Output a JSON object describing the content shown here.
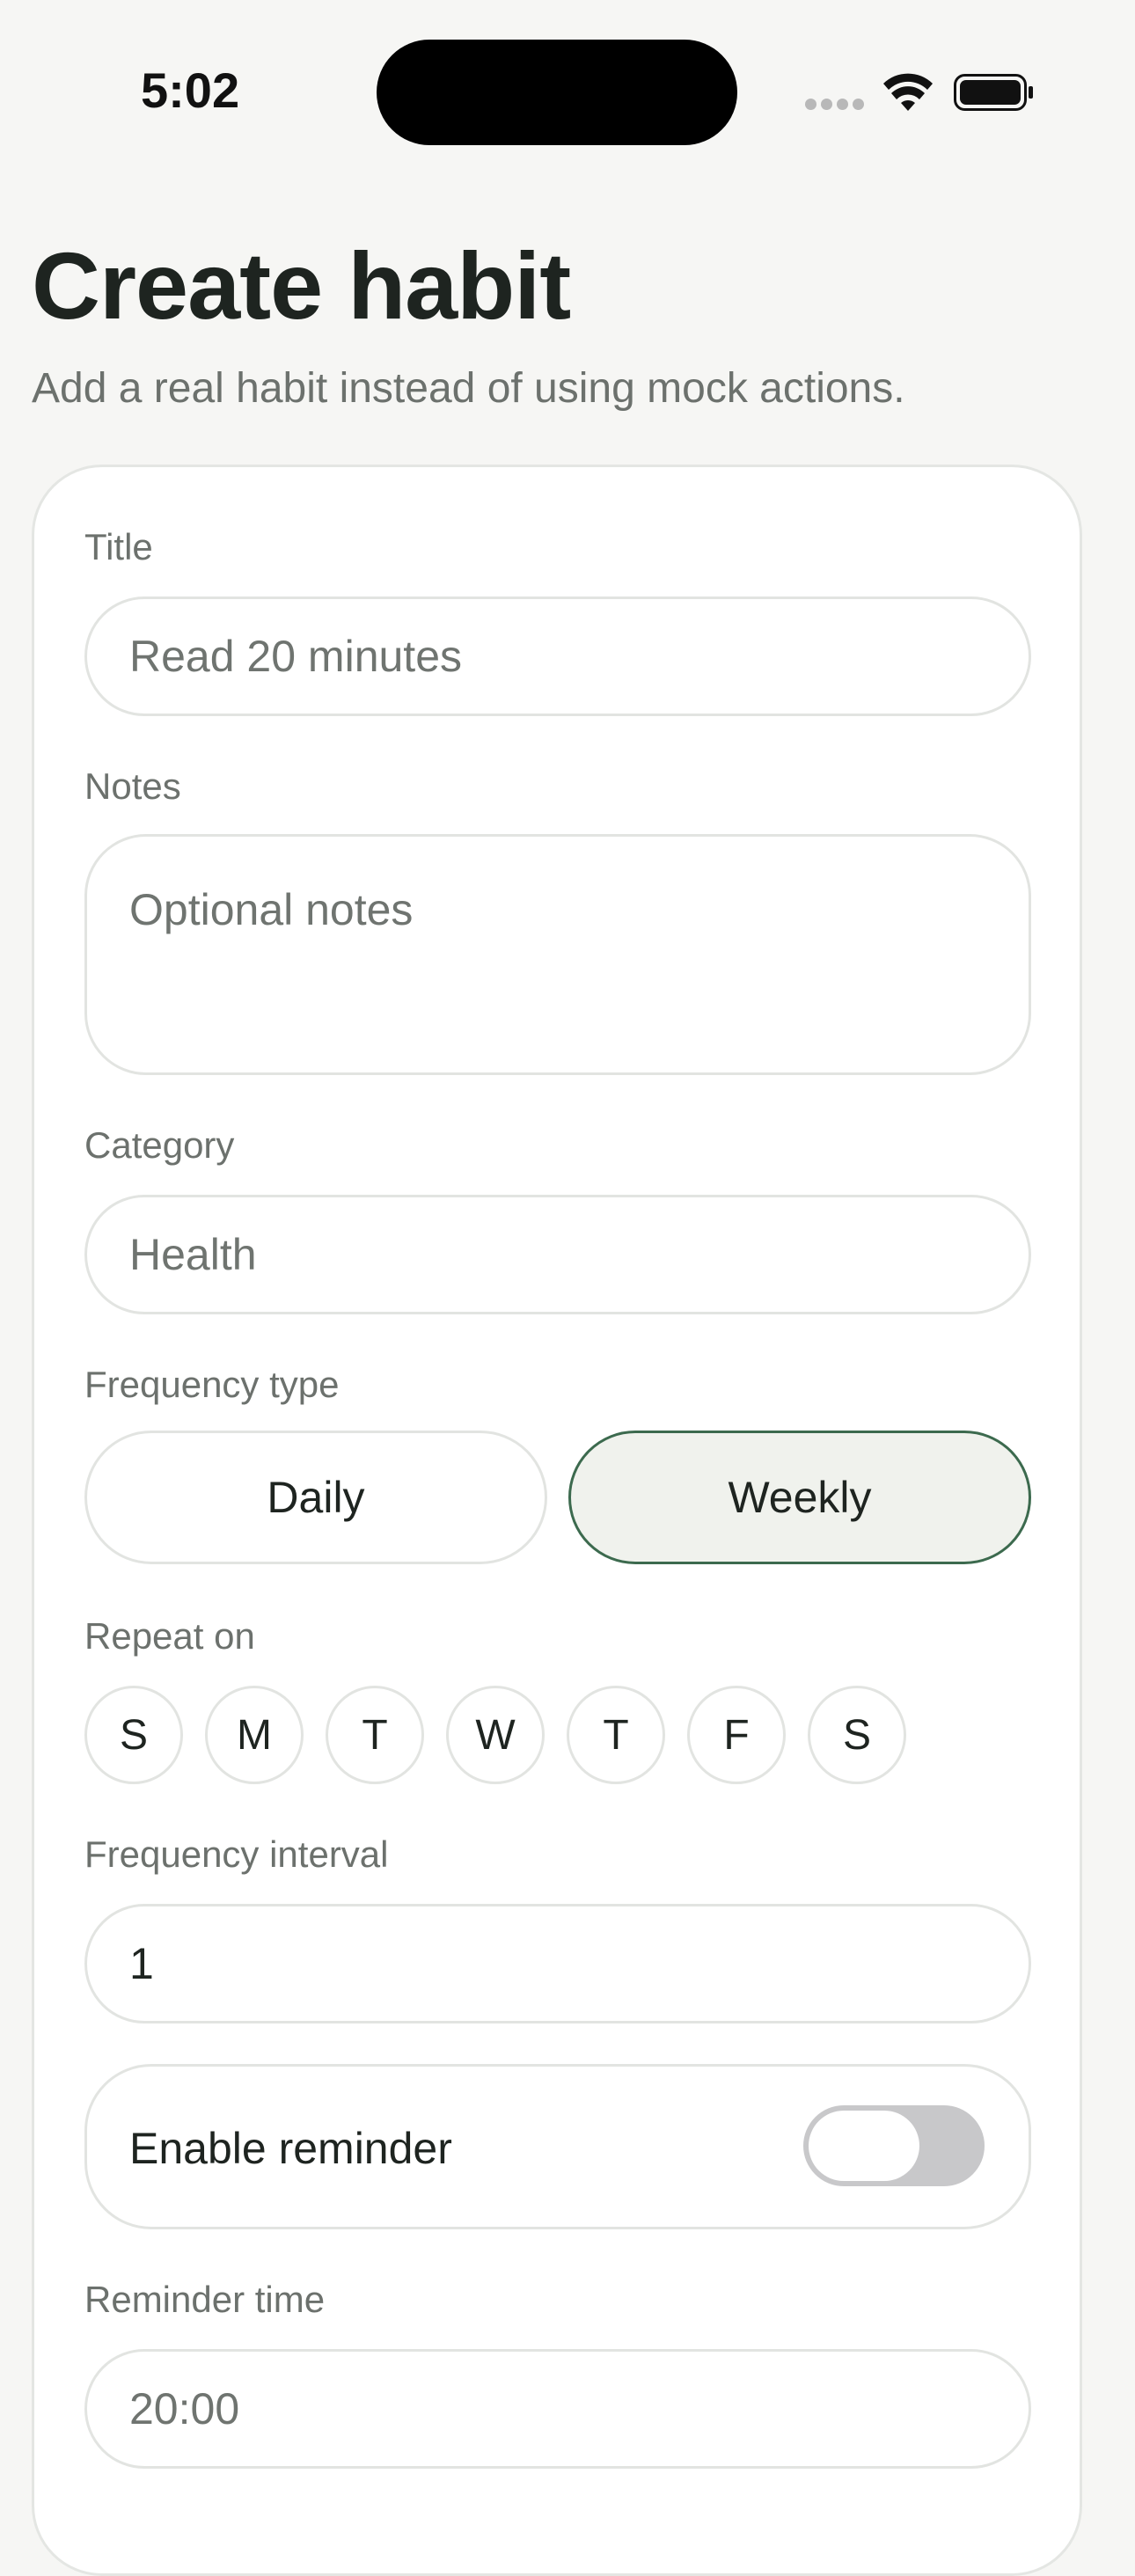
{
  "status_bar": {
    "time": "5:02",
    "icons": [
      "cellular-dots-icon",
      "wifi-icon",
      "battery-icon"
    ]
  },
  "header": {
    "title": "Create habit",
    "subtitle": "Add a real habit instead of using mock actions."
  },
  "form": {
    "title": {
      "label": "Title",
      "placeholder": "Read 20 minutes",
      "value": ""
    },
    "notes": {
      "label": "Notes",
      "placeholder": "Optional notes",
      "value": ""
    },
    "category": {
      "label": "Category",
      "placeholder": "Health",
      "value": ""
    },
    "frequency_type": {
      "label": "Frequency type",
      "options": [
        "Daily",
        "Weekly"
      ],
      "selected": "Weekly"
    },
    "repeat_on": {
      "label": "Repeat on",
      "days": [
        "S",
        "M",
        "T",
        "W",
        "T",
        "F",
        "S"
      ]
    },
    "frequency_interval": {
      "label": "Frequency interval",
      "value": "1"
    },
    "reminder": {
      "label": "Enable reminder",
      "enabled": false
    },
    "reminder_time": {
      "label": "Reminder time",
      "value": "20:00"
    }
  },
  "colors": {
    "background": "#f6f6f4",
    "accent_border": "#3c6a4e",
    "selected_fill": "#f0f2ed",
    "toggle_off": "#c8c8ca"
  }
}
